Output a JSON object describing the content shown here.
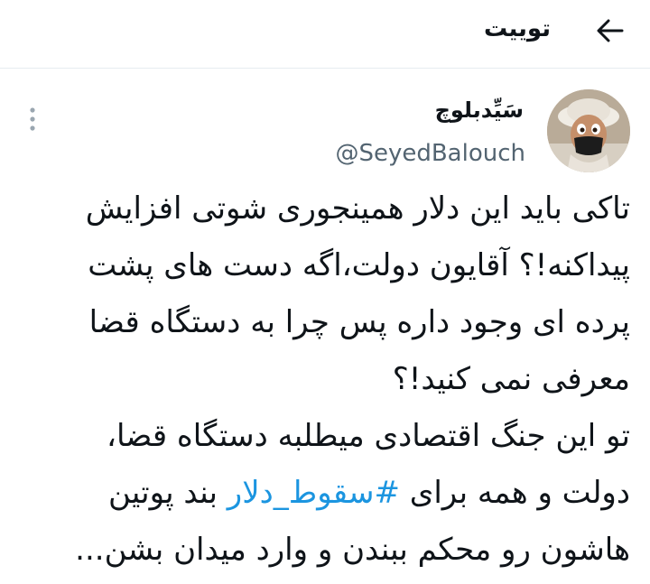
{
  "header": {
    "title": "توییت",
    "back_icon": "arrow-left-icon"
  },
  "tweet": {
    "author": {
      "display_name": "سَیِّدبلوچ",
      "handle": "@SeyedBalouch",
      "avatar_icon": "avatar-image"
    },
    "more_icon": "more-vertical-icon",
    "lines": [
      "تاکی باید این دلار همینجوری شوتی افزایش",
      "پیداکنه!؟ آقایون دولت،اگه دست های پشت",
      "پرده ای وجود داره پس چرا به دستگاه قضا",
      "معرفی نمی کنید!؟",
      "تو این جنگ اقتصادی میطلبه دستگاه قضا،",
      {
        "before": "دولت و همه برای ",
        "hashtag": "#سقوط_دلار",
        "after": " بند پوتین"
      },
      "هاشون رو محکم ببندن و وارد میدان بشن..."
    ]
  },
  "colors": {
    "text": "#0f1419",
    "secondary": "#536471",
    "hashtag": "#1b95e0",
    "divider": "#e6ecf0"
  }
}
